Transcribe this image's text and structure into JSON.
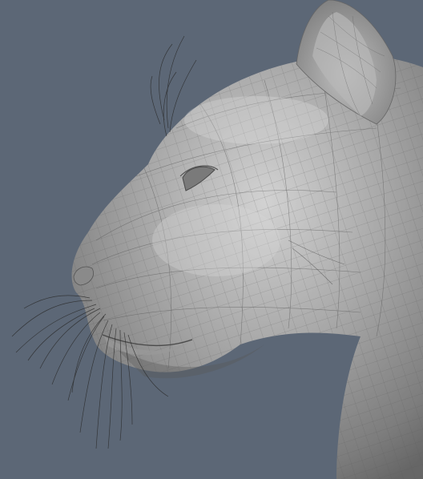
{
  "viewport": {
    "background": "#5c6776",
    "subject": "wireframe-cat-head-3d-model"
  },
  "colors": {
    "skin": "#9c9c9c",
    "skin_light": "#c9c9c9",
    "skin_dark": "#6f6f6f",
    "wire": "#555555",
    "whisker": "#2a2a2a"
  }
}
